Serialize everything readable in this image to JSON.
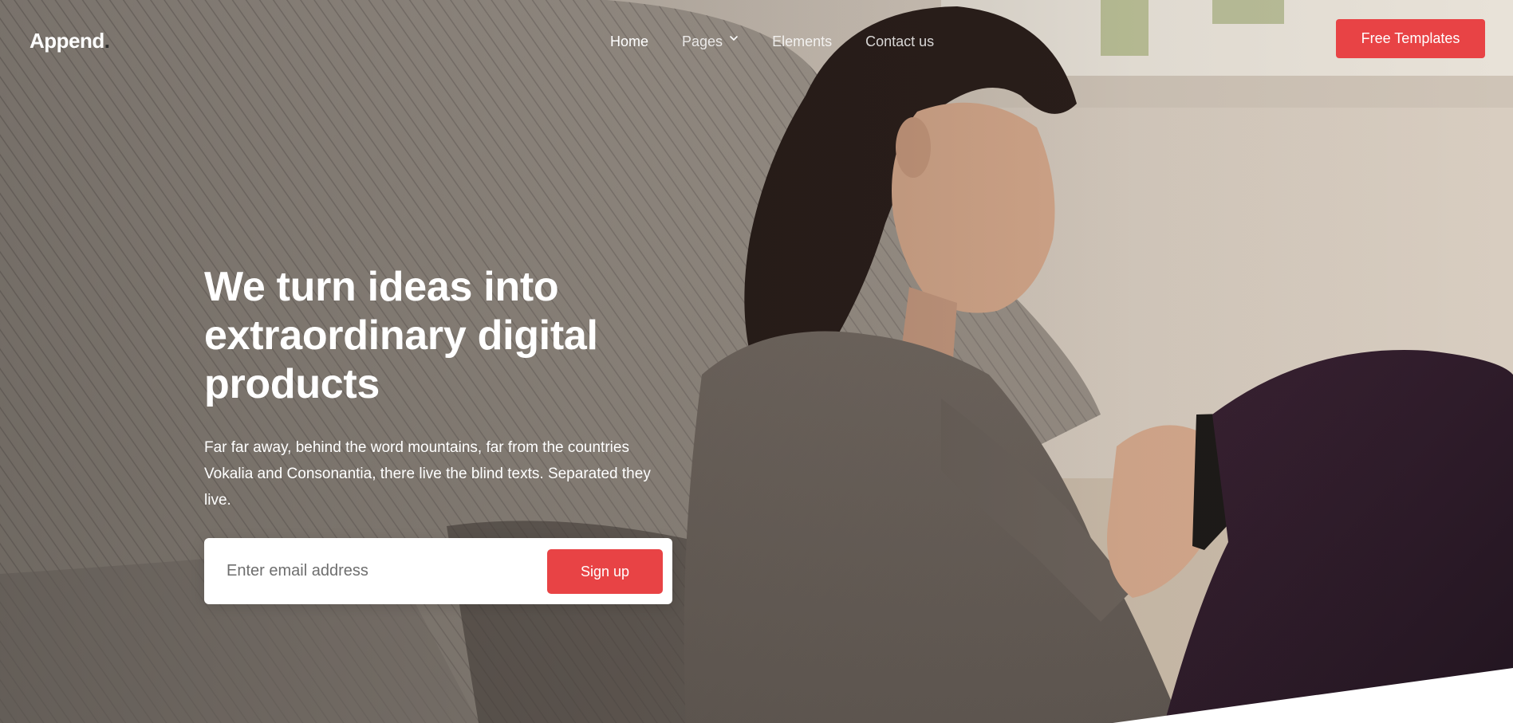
{
  "brand": {
    "name": "Append",
    "dot": "."
  },
  "nav": {
    "items": [
      {
        "label": "Home",
        "state": "active"
      },
      {
        "label": "Pages",
        "has_dropdown": true
      },
      {
        "label": "Elements"
      },
      {
        "label": "Contact us"
      }
    ],
    "cta_label": "Free Templates"
  },
  "hero": {
    "headline": "We turn ideas into extraordinary digital products",
    "lede": "Far far away, behind the word mountains, far from the countries Vokalia and Consonantia, there live the blind texts. Separated they live.",
    "background_image": "woman-sitting-on-floor-using-phone-photo"
  },
  "signup": {
    "placeholder": "Enter email address",
    "value": "",
    "button_label": "Sign up"
  },
  "icons": {
    "dropdown": "chevron-down-icon"
  },
  "colors": {
    "accent": "#e84345",
    "text_on_hero": "#ffffff",
    "logo_dot": "#2b2b2b",
    "bottom_wedge": "#ffffff"
  }
}
